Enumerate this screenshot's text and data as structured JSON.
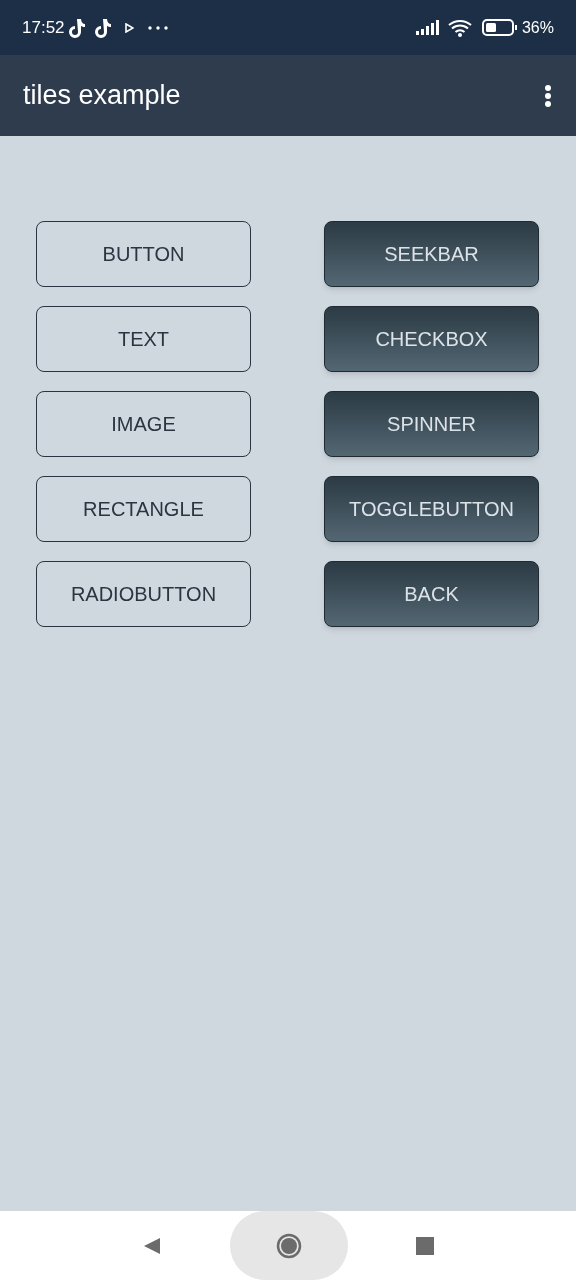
{
  "status_bar": {
    "time": "17:52",
    "battery": "36%"
  },
  "app_bar": {
    "title": "tiles example"
  },
  "buttons": [
    {
      "label": "BUTTON",
      "kind": "outlined"
    },
    {
      "label": "SEEKBAR",
      "kind": "filled"
    },
    {
      "label": "TEXT",
      "kind": "outlined"
    },
    {
      "label": "CHECKBOX",
      "kind": "filled"
    },
    {
      "label": "IMAGE",
      "kind": "outlined"
    },
    {
      "label": "SPINNER",
      "kind": "filled"
    },
    {
      "label": "RECTANGLE",
      "kind": "outlined"
    },
    {
      "label": "TOGGLEBUTTON",
      "kind": "filled"
    },
    {
      "label": "RADIOBUTTON",
      "kind": "outlined"
    },
    {
      "label": "BACK",
      "kind": "filled"
    }
  ]
}
